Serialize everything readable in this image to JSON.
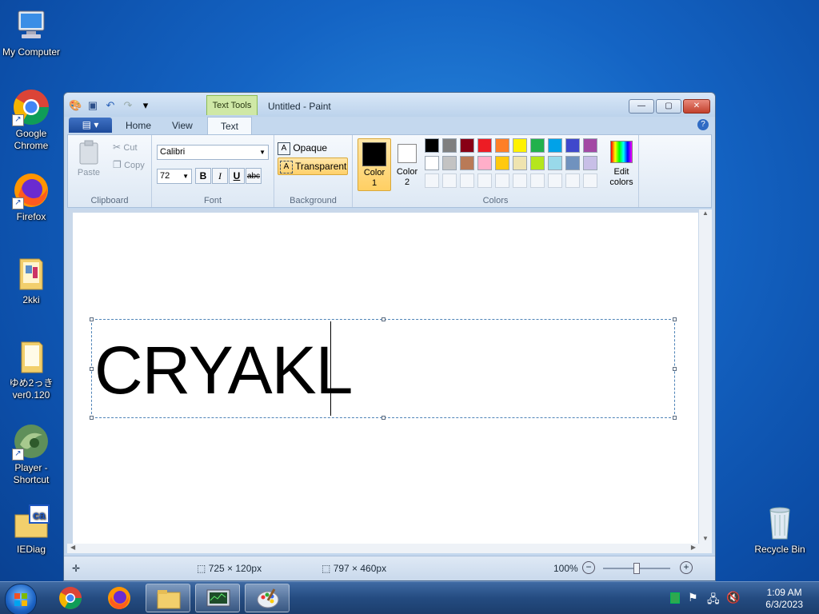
{
  "desktop": {
    "icons": [
      {
        "label": "My Computer"
      },
      {
        "label": "Google Chrome"
      },
      {
        "label": "Firefox"
      },
      {
        "label": "2kki"
      },
      {
        "label": "ゆめ2っき ver0.120"
      },
      {
        "label": "Player - Shortcut"
      },
      {
        "label": "IEDiag"
      },
      {
        "label": "Recycle Bin"
      }
    ]
  },
  "window": {
    "title": "Untitled - Paint",
    "contextual_tab": "Text Tools",
    "tabs": [
      "Home",
      "View",
      "Text"
    ],
    "active_tab": "Text",
    "buttons": {
      "minimize": "—",
      "maximize": "▢",
      "close": "✕"
    }
  },
  "ribbon": {
    "clipboard": {
      "paste": "Paste",
      "cut": "Cut",
      "copy": "Copy",
      "group_label": "Clipboard"
    },
    "font": {
      "family": "Calibri",
      "size": "72",
      "bold": "B",
      "italic": "I",
      "underline": "U",
      "strike": "abc",
      "group_label": "Font"
    },
    "background": {
      "opaque": "Opaque",
      "transparent": "Transparent",
      "group_label": "Background",
      "selected": "Transparent"
    },
    "colors": {
      "color1_label": "Color\n1",
      "color1_line1": "Color",
      "color1_line2": "1",
      "color2_line1": "Color",
      "color2_line2": "2",
      "edit_line1": "Edit",
      "edit_line2": "colors",
      "group_label": "Colors",
      "color1": "#000000",
      "color2": "#ffffff",
      "row1": [
        "#000000",
        "#7f7f7f",
        "#880015",
        "#ed1c24",
        "#ff7f27",
        "#fff200",
        "#22b14c",
        "#00a2e8",
        "#3f48cc",
        "#a349a4"
      ],
      "row2": [
        "#ffffff",
        "#c3c3c3",
        "#b97a57",
        "#ffaec9",
        "#ffc90e",
        "#efe4b0",
        "#b5e61d",
        "#99d9ea",
        "#7092be",
        "#c8bfe7"
      ]
    }
  },
  "canvas": {
    "text": "CRYAKL"
  },
  "status": {
    "selection_size": "725 × 120px",
    "canvas_size": "797 × 460px",
    "zoom": "100%"
  },
  "taskbar": {
    "time": "1:09 AM",
    "date": "6/3/2023"
  }
}
